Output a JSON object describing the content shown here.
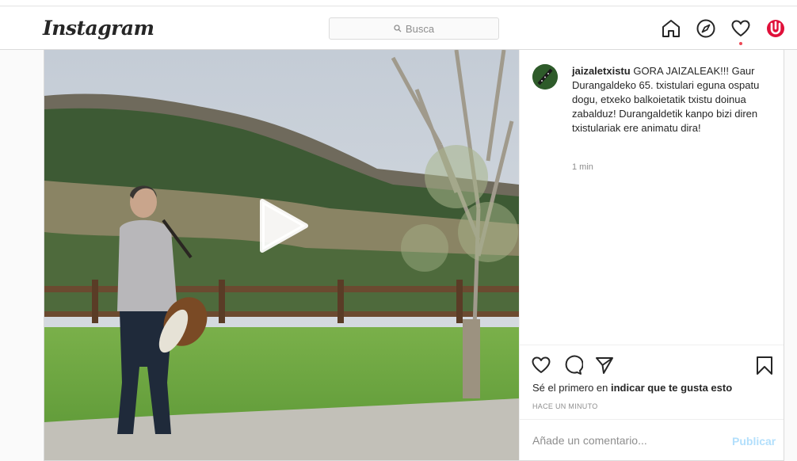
{
  "header": {
    "logo_text": "Instagram",
    "search_placeholder": "Busca",
    "icons": [
      "home-icon",
      "explore-icon",
      "activity-heart-icon",
      "profile-avatar"
    ],
    "notification_dot_color": "#ed4956"
  },
  "post": {
    "username": "jaizaletxistu",
    "caption": "GORA JAIZALEAK!!! Gaur Durangaldeko 65. txistulari eguna ospatu dogu, etxeko balkoietatik txistu doinua zabalduz! Durangaldetik kanpo bizi diren txistulariak ere animatu dira!",
    "caption_time": "1 min",
    "likes_prefix": "Sé el primero en ",
    "likes_link": "indicar que te gusta esto",
    "posted_time": "HACE UN MINUTO",
    "comment_placeholder": "Añade un comentario...",
    "publish_label": "Publicar",
    "publish_color": "#b2dffc"
  },
  "colors": {
    "border": "#dbdbdb",
    "text": "#262626",
    "muted": "#8e8e8e",
    "accent_red": "#e0103a"
  }
}
